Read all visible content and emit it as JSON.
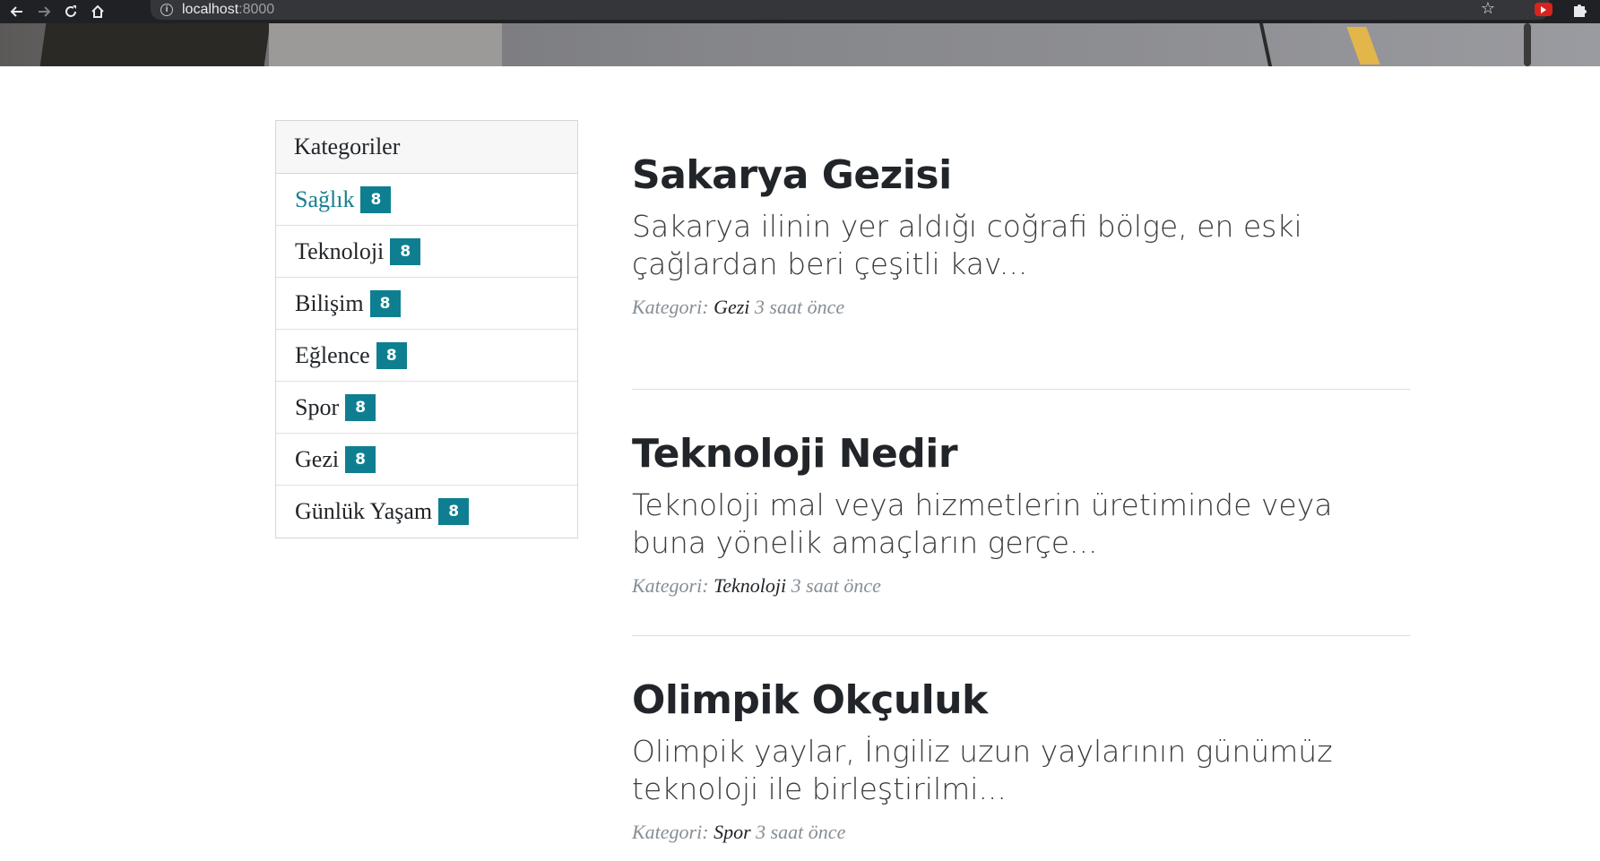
{
  "browser": {
    "url_host": "localhost",
    "url_port": ":8000"
  },
  "sidebar": {
    "title": "Kategoriler",
    "categories": [
      {
        "label": "Sağlık",
        "count": "8",
        "active": true
      },
      {
        "label": "Teknoloji",
        "count": "8"
      },
      {
        "label": "Bilişim",
        "count": "8"
      },
      {
        "label": "Eğlence",
        "count": "8"
      },
      {
        "label": "Spor",
        "count": "8"
      },
      {
        "label": "Gezi",
        "count": "8"
      },
      {
        "label": "Günlük Yaşam",
        "count": "8"
      }
    ]
  },
  "posts": [
    {
      "title": "Sakarya Gezisi",
      "excerpt": "Sakarya ilinin yer aldığı coğrafi bölge, en eski çağlardan beri çeşitli kav...",
      "meta_prefix": "Kategori:",
      "category": "Gezi",
      "time": "3 saat önce"
    },
    {
      "title": "Teknoloji Nedir",
      "excerpt": "Teknoloji mal veya hizmetlerin üretiminde veya buna yönelik amaçların gerçe...",
      "meta_prefix": "Kategori:",
      "category": "Teknoloji",
      "time": "3 saat önce"
    },
    {
      "title": "Olimpik Okçuluk",
      "excerpt": "Olimpik yaylar, İngiliz uzun yaylarının günümüz teknoloji ile birleştirilmi...",
      "meta_prefix": "Kategori:",
      "category": "Spor",
      "time": "3 saat önce"
    }
  ],
  "colors": {
    "accent": "#0e7f91",
    "active_link": "#17808f",
    "chrome_bg": "#202124"
  },
  "icons": {
    "back": "arrow-left-icon",
    "forward": "arrow-right-icon",
    "reload": "reload-icon",
    "home": "home-icon",
    "info": "info-icon",
    "bookmark": "star-icon",
    "extension_youtube": "youtube-extension-icon",
    "extensions": "puzzle-icon"
  }
}
